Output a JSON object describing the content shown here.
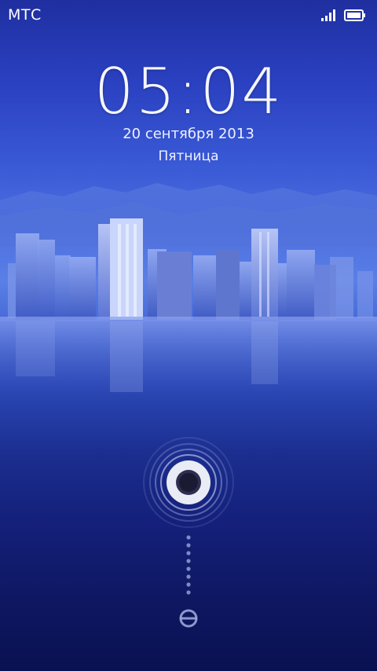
{
  "statusbar": {
    "carrier": "МТС",
    "signal_icon": "signal-bars-icon",
    "battery_icon": "battery-full-icon"
  },
  "lockscreen": {
    "time": "05:04",
    "date": "20 сентября 2013",
    "weekday": "Пятница",
    "unlock_icon": "unlock-ring-icon",
    "slide_hint_icon": "slide-dots-icon",
    "bottom_icon": "camera-icon"
  },
  "colors": {
    "text": "#f4f6ff",
    "bg_top": "#1f2fa0",
    "bg_bottom": "#0a1152"
  }
}
